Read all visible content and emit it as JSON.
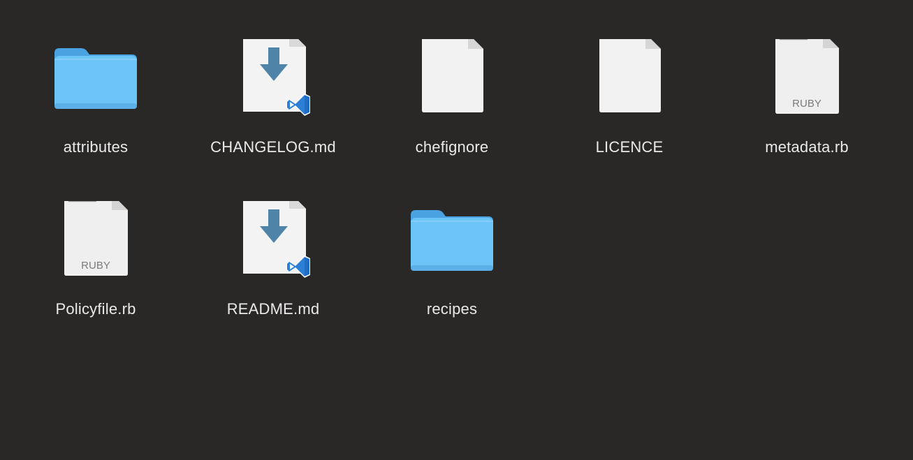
{
  "window": {
    "background": "#292827"
  },
  "colors": {
    "folder_front": "#6cc4f7",
    "folder_back": "#4aa3e0",
    "doc_white": "#f3f3f3",
    "vscode_arrow": "#4f84a8",
    "vscode_blue": "#2b7fd4",
    "label_text": "#e9e9e9"
  },
  "files": [
    {
      "name": "attributes",
      "kind": "folder",
      "icon": "folder-icon"
    },
    {
      "name": "CHANGELOG.md",
      "kind": "markdown",
      "icon": "vscode-markdown-icon"
    },
    {
      "name": "chefignore",
      "kind": "blank-document",
      "icon": "document-icon"
    },
    {
      "name": "LICENCE",
      "kind": "blank-document",
      "icon": "document-icon"
    },
    {
      "name": "metadata.rb",
      "kind": "ruby",
      "icon": "ruby-file-icon",
      "badge": "RUBY"
    },
    {
      "name": "Policyfile.rb",
      "kind": "ruby",
      "icon": "ruby-file-icon",
      "badge": "RUBY"
    },
    {
      "name": "README.md",
      "kind": "markdown",
      "icon": "vscode-markdown-icon"
    },
    {
      "name": "recipes",
      "kind": "folder",
      "icon": "folder-icon"
    }
  ]
}
